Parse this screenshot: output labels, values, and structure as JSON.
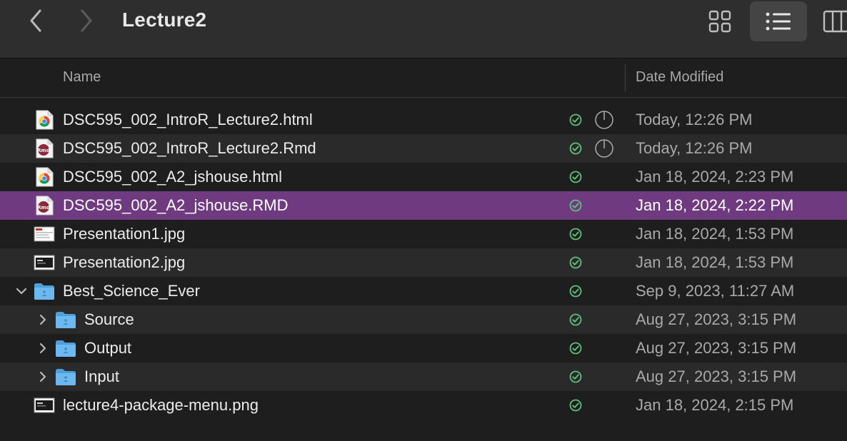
{
  "window": {
    "title": "Lecture2"
  },
  "toolbar": {
    "back": "back-icon",
    "forward": "forward-icon",
    "views": [
      "icon-view-icon",
      "list-view-icon",
      "column-view-icon"
    ],
    "active_view": "list"
  },
  "columns": {
    "name": "Name",
    "date": "Date Modified"
  },
  "colors": {
    "selection": "#6f3a80",
    "sync_ok": "#5fbf7a",
    "folder": "#5aaef0"
  },
  "files": [
    {
      "name": "DSC595_002_IntroR_Lecture2.html",
      "date": "Today, 12:26 PM",
      "icon": "chrome-html-icon",
      "pending": true
    },
    {
      "name": "DSC595_002_IntroR_Lecture2.Rmd",
      "date": "Today, 12:26 PM",
      "icon": "rmd-file-icon",
      "pending": true
    },
    {
      "name": "DSC595_002_A2_jshouse.html",
      "date": "Jan 18, 2024, 2:23 PM",
      "icon": "chrome-html-icon"
    },
    {
      "name": "DSC595_002_A2_jshouse.RMD",
      "date": "Jan 18, 2024, 2:22 PM",
      "icon": "rmd-file-icon",
      "selected": true
    },
    {
      "name": "Presentation1.jpg",
      "date": "Jan 18, 2024, 1:53 PM",
      "icon": "image-light-icon"
    },
    {
      "name": "Presentation2.jpg",
      "date": "Jan 18, 2024, 1:53 PM",
      "icon": "image-dark-icon"
    },
    {
      "name": "Best_Science_Ever",
      "date": "Sep 9, 2023, 11:27 AM",
      "icon": "folder-icon",
      "disclosure": "expanded"
    },
    {
      "name": "Source",
      "date": "Aug 27, 2023, 3:15 PM",
      "icon": "folder-icon",
      "disclosure": "collapsed",
      "level": 1
    },
    {
      "name": "Output",
      "date": "Aug 27, 2023, 3:15 PM",
      "icon": "folder-icon",
      "disclosure": "collapsed",
      "level": 1
    },
    {
      "name": "Input",
      "date": "Aug 27, 2023, 3:15 PM",
      "icon": "folder-icon",
      "disclosure": "collapsed",
      "level": 1
    },
    {
      "name": "lecture4-package-menu.png",
      "date": "Jan 18, 2024, 2:15 PM",
      "icon": "image-dark-icon"
    }
  ]
}
